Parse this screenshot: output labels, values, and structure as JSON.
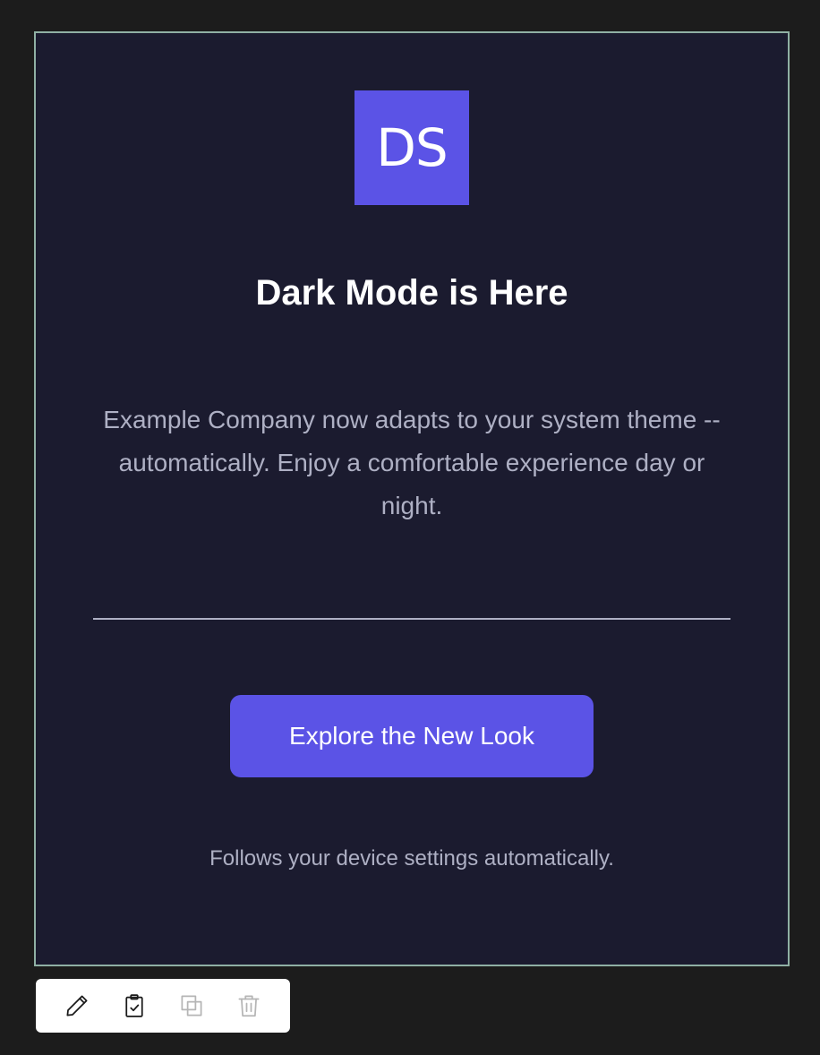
{
  "email": {
    "logo_text": "DS",
    "headline": "Dark Mode is Here",
    "body": "Example Company now adapts to your system theme -- automatically. Enjoy a comfortable experience day or night.",
    "cta_label": "Explore the New Look",
    "footnote": "Follows your device settings automatically."
  },
  "toolbar": {
    "icons": [
      "pencil-icon",
      "clipboard-check-icon",
      "duplicate-icon",
      "trash-icon"
    ]
  },
  "colors": {
    "page_background": "#1c1c1c",
    "email_background": "#1b1b2f",
    "accent": "#5b53e6",
    "muted_text": "#aeb0c4",
    "frame_border": "#8fb0a4",
    "icon_active": "#1a1a1a",
    "icon_disabled": "#b5b5b5"
  }
}
